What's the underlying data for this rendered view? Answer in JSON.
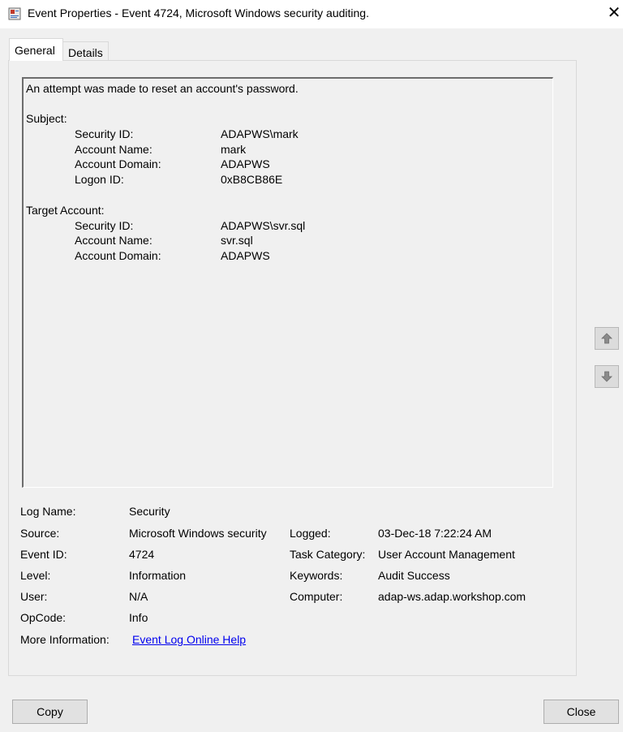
{
  "window": {
    "title": "Event Properties - Event 4724, Microsoft Windows security auditing.",
    "icon": "event-viewer-icon",
    "close_glyph": "✕"
  },
  "tabs": [
    {
      "label": "General",
      "selected": true
    },
    {
      "label": "Details",
      "selected": false
    }
  ],
  "description": {
    "intro": "An attempt was made to reset an account's password.",
    "subject_heading": "Subject:",
    "subject": [
      {
        "label": "Security ID:",
        "value": "ADAPWS\\mark"
      },
      {
        "label": "Account Name:",
        "value": "mark"
      },
      {
        "label": "Account Domain:",
        "value": "ADAPWS"
      },
      {
        "label": "Logon ID:",
        "value": "0xB8CB86E"
      }
    ],
    "target_heading": "Target Account:",
    "target": [
      {
        "label": "Security ID:",
        "value": "ADAPWS\\svr.sql"
      },
      {
        "label": "Account Name:",
        "value": "svr.sql"
      },
      {
        "label": "Account Domain:",
        "value": "ADAPWS"
      }
    ]
  },
  "fields": {
    "log_name": {
      "label": "Log Name:",
      "value": "Security"
    },
    "source": {
      "label": "Source:",
      "value": "Microsoft Windows security"
    },
    "logged": {
      "label": "Logged:",
      "value": "03-Dec-18 7:22:24 AM"
    },
    "event_id": {
      "label": "Event ID:",
      "value": "4724"
    },
    "task_category": {
      "label": "Task Category:",
      "value": "User Account Management"
    },
    "level": {
      "label": "Level:",
      "value": "Information"
    },
    "keywords": {
      "label": "Keywords:",
      "value": "Audit Success"
    },
    "user": {
      "label": "User:",
      "value": "N/A"
    },
    "computer": {
      "label": "Computer:",
      "value": "adap-ws.adap.workshop.com"
    },
    "opcode": {
      "label": "OpCode:",
      "value": "Info"
    },
    "more_info": {
      "label": "More Information:",
      "link": "Event Log Online Help"
    }
  },
  "nav": {
    "up_icon": "arrow-up-icon",
    "down_icon": "arrow-down-icon"
  },
  "buttons": {
    "copy": "Copy",
    "close": "Close"
  },
  "colors": {
    "link": "#0000ee",
    "background": "#f0f0f0"
  }
}
